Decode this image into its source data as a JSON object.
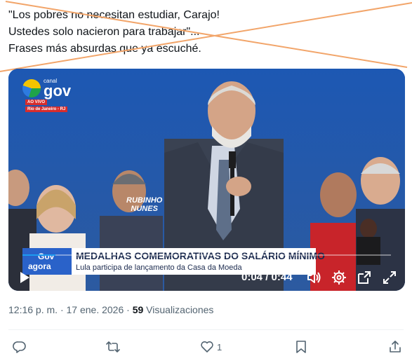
{
  "tweet": {
    "lines": [
      "\"Los pobres no necesitan estudiar, Carajo!",
      "Ustedes solo nacieron para trabajar\"...",
      "Frases más absurdas que ya escuché."
    ]
  },
  "video": {
    "channel_small": "canal",
    "channel_big": "gov",
    "live_label": "AO VIVO",
    "location": "Rio de Janeiro - RJ",
    "name_tag_line1": "RUBINHO",
    "name_tag_line2": "NUNES",
    "banner_logo_line1": "Gov",
    "banner_logo_line2": "agora",
    "banner_title": "MEDALHAS COMEMORATIVAS DO SALÁRIO MÍNIMO",
    "banner_subtitle": "Lula participa de lançamento da Casa da Moeda",
    "time": "0:04 / 0:44",
    "progress": 0.09
  },
  "meta": {
    "time": "12:16 p. m.",
    "date": "17 ene. 2026",
    "views_count": "59",
    "views_label": "Visualizaciones"
  },
  "actions": {
    "likes": "1"
  },
  "colors": {
    "cross_line": "#f2a56a",
    "stage_blue": "#1f4f9a",
    "banner_blue": "#2a62c9",
    "text_secondary": "#536471"
  }
}
